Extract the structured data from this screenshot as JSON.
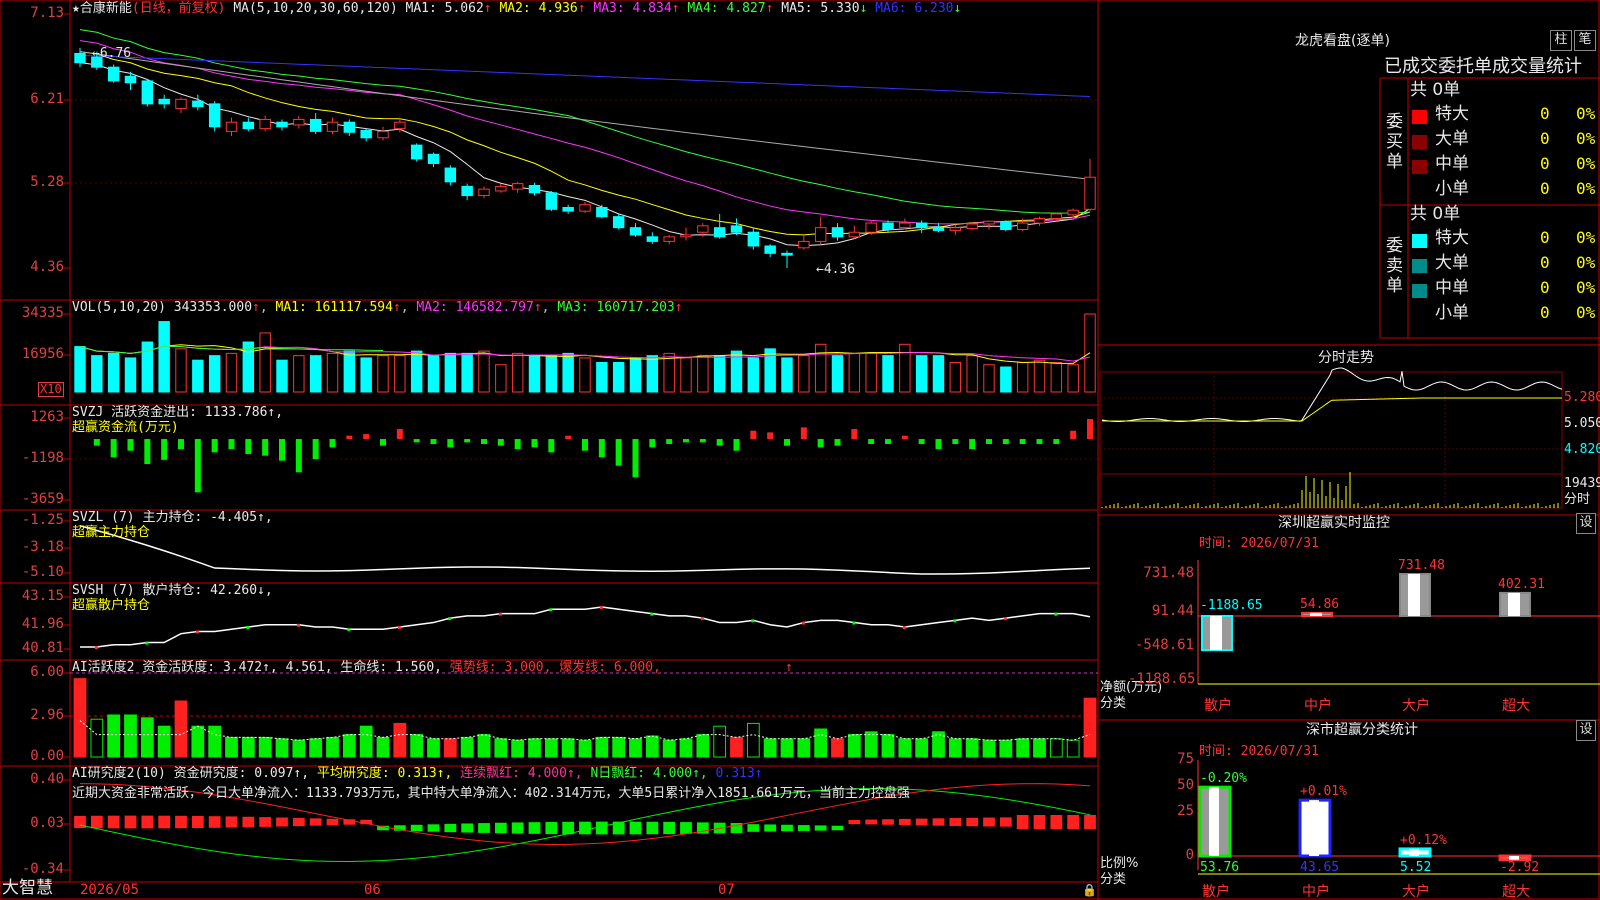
{
  "header": {
    "stock_name": "★合康新能",
    "period": "(日线，前复权)",
    "ma_label": "MA(5,10,20,30,60,120)",
    "ma_values": [
      {
        "label": "MA1: ",
        "value": "5.062",
        "arrow": "↑",
        "color": "#e8e8e8"
      },
      {
        "label": "MA2: ",
        "value": "4.936",
        "arrow": "↑",
        "color": "#ffff00"
      },
      {
        "label": "MA3: ",
        "value": "4.834",
        "arrow": "↑",
        "color": "#ff33ff"
      },
      {
        "label": "MA4: ",
        "value": "4.827",
        "arrow": "↑",
        "color": "#33ff33"
      },
      {
        "label": "MA5: ",
        "value": "5.330",
        "arrow": "↓",
        "color": "#e8e8e8"
      },
      {
        "label": "MA6: ",
        "value": "6.230",
        "arrow": "↓",
        "color": "#3333ff"
      }
    ]
  },
  "indicators": {
    "vol": {
      "title": "VOL(5,10,20)",
      "value": "343353.000",
      "ma1": "161117.594",
      "ma2": "146582.797",
      "ma3": "160717.203",
      "unit": "X10"
    },
    "svzj": {
      "title": "SVZJ 活跃资金进出: 1133.786↑,",
      "subtitle": "超赢资金流(万元)"
    },
    "svzl": {
      "title": "SVZL (7) 主力持仓: -4.405↑,",
      "subtitle": "超赢主力持仓"
    },
    "svsh": {
      "title": "SVSH (7) 散户持仓: 42.260↓,",
      "subtitle": "超赢散户持仓"
    },
    "ai1": {
      "title_a": "AI活跃度2 资金活跃度: 3.472↑, 4.561, 生命线: 1.560,",
      "title_b": " 强势线: 3.000, 爆发线: 6.000,",
      "arrow": "↑"
    },
    "ai2": {
      "title_a": "AI研究度2(10) 资金研究度: 0.097↑,",
      "title_b": " 平均研究度: 0.313↑,",
      "title_c": " 连续飘红: 4.000↑,",
      "title_d": " N日飘红: 4.000↑,",
      "title_e": " 0.313↑",
      "comment": "近期大资金非常活跃，今日大单净流入：1133.793万元，其中特大单净流入：402.314万元，大单5日累计净入1851.661万元，当前主力控盘强"
    }
  },
  "axes": {
    "price": [
      "7.13",
      "6.21",
      "5.28",
      "4.36"
    ],
    "vol": [
      "34335",
      "16956"
    ],
    "svzj": [
      "1263",
      "-1198",
      "-3659"
    ],
    "svzl": [
      "-1.25",
      "-3.18",
      "-5.10"
    ],
    "svsh": [
      "43.15",
      "41.96",
      "40.81"
    ],
    "ai1": [
      "6.00",
      "2.96",
      "0.00"
    ],
    "ai2": [
      "0.40",
      "0.03",
      "-0.34"
    ],
    "dates": [
      "2026/05",
      "06",
      "07"
    ]
  },
  "price_annotations": {
    "high": "6.76",
    "low": "4.36"
  },
  "logo": "大智慧",
  "right_panel": {
    "dragon_tiger": {
      "title": "龙虎看盘(逐单)",
      "btn_pillar": "柱",
      "btn_pen": "笔",
      "subtitle": "已成交委托单成交量统计",
      "buy": {
        "total": "共 0单",
        "side_label": "委买单",
        "rows": [
          {
            "name": "特大",
            "count": "0",
            "pct": "0%"
          },
          {
            "name": "大单",
            "count": "0",
            "pct": "0%"
          },
          {
            "name": "中单",
            "count": "0",
            "pct": "0%"
          },
          {
            "name": "小单",
            "count": "0",
            "pct": "0%"
          }
        ]
      },
      "sell": {
        "total": "共 0单",
        "side_label": "委卖单",
        "rows": [
          {
            "name": "特大",
            "count": "0",
            "pct": "0%"
          },
          {
            "name": "大单",
            "count": "0",
            "pct": "0%"
          },
          {
            "name": "中单",
            "count": "0",
            "pct": "0%"
          },
          {
            "name": "小单",
            "count": "0",
            "pct": "0%"
          }
        ]
      }
    },
    "intraday": {
      "title": "分时走势",
      "prices": [
        "5.280",
        "5.050",
        "4.820"
      ],
      "volume": "19439",
      "vol_label": "分时"
    },
    "monitor": {
      "title": "深圳超赢实时监控",
      "btn": "设",
      "time": "时间: 2026/07/31",
      "yticks": [
        "731.48",
        "91.44",
        "-548.61",
        "-1188.65"
      ],
      "ylabel": "净额(万元)",
      "xlabel": "分类",
      "bars": [
        {
          "cat": "散户",
          "value": "-1188.65"
        },
        {
          "cat": "中户",
          "value": "54.86"
        },
        {
          "cat": "大户",
          "value": "731.48"
        },
        {
          "cat": "超大",
          "value": "402.31"
        }
      ]
    },
    "classify": {
      "title": "深市超赢分类统计",
      "btn": "设",
      "time": "时间: 2026/07/31",
      "yticks": [
        "75",
        "50",
        "25",
        "0"
      ],
      "ylabel": "比例%",
      "xlabel": "分类",
      "bars": [
        {
          "cat": "散户",
          "value": "53.76",
          "change": "-0.20%"
        },
        {
          "cat": "中户",
          "value": "43.65",
          "change": "+0.01%"
        },
        {
          "cat": "大户",
          "value": "5.52",
          "change": "+0.12%"
        },
        {
          "cat": "超大",
          "value": "-2.92",
          "change": ""
        }
      ]
    }
  },
  "chart_data": [
    {
      "type": "candlestick",
      "title": "合康新能",
      "ylim": [
        4.2,
        7.2
      ],
      "x": [
        "2026/05",
        "06",
        "07"
      ],
      "series": [
        {
          "name": "MA1",
          "values": [
            5.062
          ]
        },
        {
          "name": "MA2",
          "values": [
            4.936
          ]
        },
        {
          "name": "MA3",
          "values": [
            4.834
          ]
        },
        {
          "name": "MA4",
          "values": [
            4.827
          ]
        },
        {
          "name": "MA5",
          "values": [
            5.33
          ]
        },
        {
          "name": "MA6",
          "values": [
            6.23
          ]
        }
      ],
      "high": 6.76,
      "low": 4.36,
      "ohlc": [
        [
          6.7,
          6.6,
          6.76,
          6.55
        ],
        [
          6.66,
          6.55,
          6.72,
          6.52
        ],
        [
          6.55,
          6.4,
          6.58,
          6.38
        ],
        [
          6.45,
          6.38,
          6.5,
          6.3
        ],
        [
          6.4,
          6.15,
          6.42,
          6.12
        ],
        [
          6.2,
          6.15,
          6.25,
          6.1
        ],
        [
          6.1,
          6.2,
          6.22,
          6.05
        ],
        [
          6.18,
          6.12,
          6.25,
          6.08
        ],
        [
          6.15,
          5.9,
          6.18,
          5.85
        ],
        [
          5.85,
          5.95,
          6.0,
          5.8
        ],
        [
          5.95,
          5.88,
          6.0,
          5.85
        ],
        [
          5.88,
          5.98,
          6.02,
          5.85
        ],
        [
          5.95,
          5.9,
          5.98,
          5.86
        ],
        [
          5.92,
          5.98,
          6.02,
          5.88
        ],
        [
          5.98,
          5.85,
          6.05,
          5.82
        ],
        [
          5.85,
          5.95,
          6.0,
          5.82
        ],
        [
          5.95,
          5.84,
          5.98,
          5.8
        ],
        [
          5.86,
          5.78,
          5.88,
          5.74
        ],
        [
          5.78,
          5.85,
          5.9,
          5.75
        ],
        [
          5.88,
          5.95,
          6.0,
          5.84
        ],
        [
          5.7,
          5.55,
          5.72,
          5.52
        ],
        [
          5.6,
          5.5,
          5.62,
          5.46
        ],
        [
          5.45,
          5.3,
          5.48,
          5.26
        ],
        [
          5.25,
          5.15,
          5.28,
          5.1
        ],
        [
          5.15,
          5.22,
          5.25,
          5.12
        ],
        [
          5.2,
          5.25,
          5.28,
          5.18
        ],
        [
          5.22,
          5.28,
          5.3,
          5.18
        ],
        [
          5.26,
          5.18,
          5.29,
          5.15
        ],
        [
          5.18,
          5.0,
          5.2,
          4.98
        ],
        [
          5.02,
          4.98,
          5.05,
          4.95
        ],
        [
          4.98,
          5.05,
          5.08,
          4.96
        ],
        [
          5.02,
          4.92,
          5.05,
          4.9
        ],
        [
          4.92,
          4.8,
          4.95,
          4.78
        ],
        [
          4.8,
          4.72,
          4.85,
          4.7
        ],
        [
          4.7,
          4.65,
          4.75,
          4.62
        ],
        [
          4.65,
          4.7,
          4.72,
          4.62
        ],
        [
          4.7,
          4.72,
          4.8,
          4.66
        ],
        [
          4.75,
          4.82,
          4.85,
          4.7
        ],
        [
          4.8,
          4.7,
          4.95,
          4.68
        ],
        [
          4.82,
          4.75,
          4.9,
          4.72
        ],
        [
          4.75,
          4.6,
          4.8,
          4.56
        ],
        [
          4.6,
          4.52,
          4.62,
          4.48
        ],
        [
          4.52,
          4.5,
          4.55,
          4.36
        ],
        [
          4.58,
          4.65,
          4.72,
          4.56
        ],
        [
          4.65,
          4.8,
          4.92,
          4.62
        ],
        [
          4.8,
          4.7,
          4.85,
          4.66
        ],
        [
          4.7,
          4.75,
          4.82,
          4.68
        ],
        [
          4.75,
          4.85,
          4.88,
          4.72
        ],
        [
          4.85,
          4.78,
          4.88,
          4.75
        ],
        [
          4.8,
          4.85,
          4.9,
          4.78
        ],
        [
          4.85,
          4.8,
          4.88,
          4.74
        ],
        [
          4.8,
          4.77,
          4.85,
          4.75
        ],
        [
          4.77,
          4.8,
          4.83,
          4.72
        ],
        [
          4.79,
          4.84,
          4.86,
          4.77
        ],
        [
          4.84,
          4.87,
          4.88,
          4.78
        ],
        [
          4.86,
          4.78,
          4.88,
          4.76
        ],
        [
          4.78,
          4.85,
          4.9,
          4.76
        ],
        [
          4.85,
          4.9,
          4.92,
          4.82
        ],
        [
          4.9,
          4.95,
          4.96,
          4.87
        ],
        [
          4.94,
          4.99,
          5.01,
          4.91
        ],
        [
          5.0,
          5.35,
          5.55,
          4.98
        ]
      ],
      "vol": [
        20000,
        16000,
        17000,
        15000,
        22000,
        31000,
        19000,
        14000,
        16000,
        17000,
        22000,
        26000,
        14000,
        16000,
        16000,
        17000,
        18000,
        15000,
        16000,
        16000,
        18000,
        16000,
        17000,
        17000,
        18000,
        12000,
        17000,
        16000,
        16000,
        17000,
        15000,
        13000,
        13000,
        15000,
        16000,
        17000,
        15000,
        16000,
        16000,
        18000,
        15000,
        19000,
        15000,
        16000,
        21000,
        16000,
        17000,
        17000,
        16000,
        21000,
        16000,
        16000,
        13000,
        16000,
        12000,
        11000,
        13000,
        14000,
        13000,
        12000,
        34335
      ]
    },
    {
      "type": "bar",
      "title": "SVZJ",
      "values": [
        -400,
        -1100,
        -700,
        -1500,
        -1250,
        -600,
        -3200,
        -800,
        -600,
        -900,
        -1000,
        -1300,
        -2000,
        -1200,
        -500,
        200,
        300,
        -400,
        600,
        -200,
        -300,
        -500,
        -200,
        -300,
        -400,
        -600,
        -500,
        -800,
        200,
        -700,
        -1100,
        -1600,
        -2300,
        -500,
        -300,
        -200,
        -200,
        -400,
        -700,
        500,
        400,
        -400,
        700,
        -500,
        -400,
        600,
        -300,
        -300,
        200,
        -300,
        -600,
        -300,
        -600,
        -300,
        -300,
        -300,
        -300,
        -300,
        500,
        1200
      ],
      "ylim": [
        -3659,
        1263
      ]
    },
    {
      "type": "line",
      "title": "SVZL",
      "ylim": [
        -5.1,
        -1.25
      ]
    },
    {
      "type": "line",
      "title": "SVSH",
      "ylim": [
        40.81,
        43.15
      ]
    },
    {
      "type": "bar",
      "title": "AI活跃度2",
      "ylim": [
        0,
        6.0
      ]
    },
    {
      "type": "bar",
      "title": "AI研究度2",
      "ylim": [
        -0.34,
        0.4
      ]
    },
    {
      "type": "bar",
      "title": "深圳超赢实时监控",
      "categories": [
        "散户",
        "中户",
        "大户",
        "超大"
      ],
      "values": [
        -1188.65,
        54.86,
        731.48,
        402.31
      ]
    },
    {
      "type": "bar",
      "title": "深市超赢分类统计",
      "categories": [
        "散户",
        "中户",
        "大户",
        "超大"
      ],
      "values": [
        53.76,
        43.65,
        5.52,
        -2.92
      ]
    }
  ]
}
